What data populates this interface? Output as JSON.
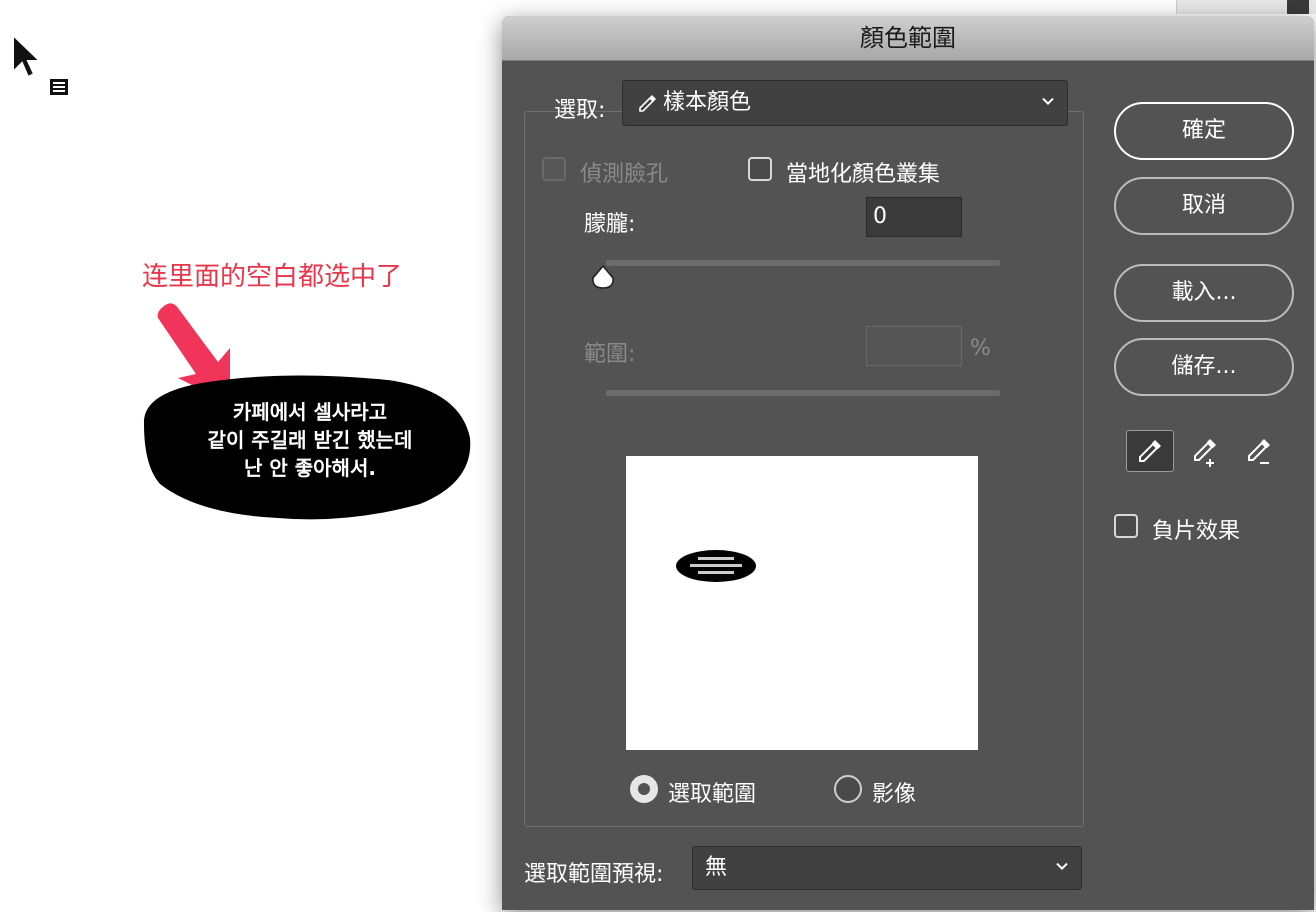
{
  "canvas": {
    "annotation_text": "连里面的空白都选中了",
    "blob_text_lines": [
      "카페에서 셀사라고",
      "같이 주길래 받긴 했는데",
      "난 안 좋아해서."
    ],
    "annotation_color": "#e8364b"
  },
  "dialog": {
    "title": "顏色範圍",
    "select_label": "選取:",
    "select_value": "樣本顏色",
    "select_icon": "eyedropper-icon",
    "detect_faces_label": "偵測臉孔",
    "detect_faces_checked": false,
    "detect_faces_enabled": false,
    "localized_clusters_label": "當地化顏色叢集",
    "localized_clusters_checked": false,
    "fuzziness_label": "朦朧:",
    "fuzziness_value": "0",
    "range_label": "範圍:",
    "range_value": "",
    "range_unit": "%",
    "preview_mode_selection_label": "選取範圍",
    "preview_mode_image_label": "影像",
    "preview_mode_selected": "選取範圍",
    "selection_preview_label": "選取範圍預視:",
    "selection_preview_value": "無"
  },
  "buttons": {
    "ok": "確定",
    "cancel": "取消",
    "load": "載入...",
    "save": "儲存..."
  },
  "tools": [
    "eyedropper-icon",
    "eyedropper-plus-icon",
    "eyedropper-minus-icon"
  ],
  "invert_label": "負片效果",
  "invert_checked": false,
  "colors": {
    "dialog_bg": "#535353",
    "titlebar": "#b8b8b8",
    "field_bg": "#414141"
  }
}
